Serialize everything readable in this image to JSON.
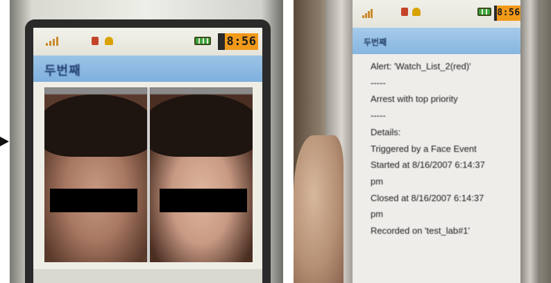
{
  "left_phone": {
    "status": {
      "time": "8:56"
    },
    "title": "두번째",
    "face_panels": [
      {
        "caption": ""
      },
      {
        "caption": ""
      }
    ]
  },
  "right_phone": {
    "status": {
      "time": "8:56"
    },
    "title": "두번째",
    "message_lines": [
      "Alert: 'Watch_List_2(red)'",
      "-----",
      "Arrest with top priority",
      "-----",
      "Details:",
      "Triggered by a Face Event",
      "Started at 8/16/2007 6:14:37",
      "pm",
      "Closed at 8/16/2007 6:14:37",
      "pm",
      "Recorded on 'test_lab#1'"
    ]
  },
  "colors": {
    "title_bar": "#8fbae3",
    "clock_bg": "#f19a1a",
    "redaction": "#000000"
  }
}
